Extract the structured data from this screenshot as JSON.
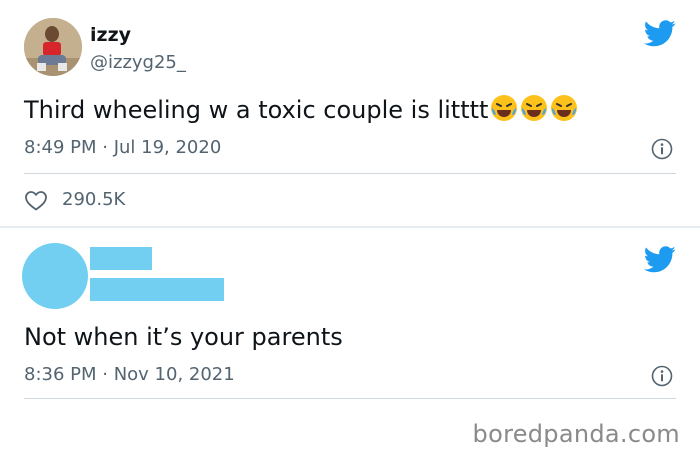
{
  "tweets": [
    {
      "author": {
        "name": "izzy",
        "handle": "@izzyg25_"
      },
      "text": "Third wheeling w a toxic couple is litttt",
      "emojis": [
        "face-with-tears-of-joy",
        "face-with-tears-of-joy",
        "face-with-tears-of-joy"
      ],
      "timestamp": "8:49 PM · Jul 19, 2020",
      "likes": "290.5K"
    },
    {
      "author_redacted": true,
      "text": "Not when it’s your parents",
      "timestamp": "8:36 PM · Nov 10, 2021"
    }
  ],
  "watermark": "boredpanda.com",
  "colors": {
    "brand": "#1d9bf0",
    "redaction": "#72cff2",
    "secondary_text": "#536471",
    "divider": "#cfd9de"
  }
}
